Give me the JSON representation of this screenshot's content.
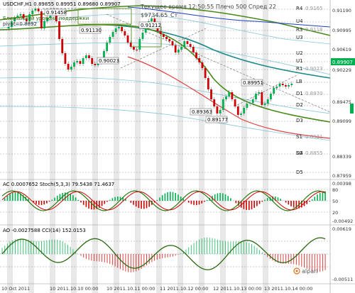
{
  "header": {
    "symbol_info": "USDCHF,H1  0.89855 0.89951 0.89680 0.89907",
    "nearest_level_label": "Ближайший уровень поддержки",
    "pivot_label": "pivot=0.8892",
    "server_time": "Текущее время 12:50:55 Плечо 500 Спред 22",
    "balance": "$9734.65",
    "balance_suffix": "Ст"
  },
  "price_axis": {
    "ticks": [
      "0.91190",
      "0.90995",
      "0.90619",
      "0.90229",
      "0.89907",
      "0.89475",
      "0.89099",
      "0.88339",
      "0.87959"
    ],
    "current": "0.89907",
    "current_color": "#00b050"
  },
  "pivot_levels": [
    {
      "name": "R4",
      "value": "0.9165"
    },
    {
      "name": "U4",
      "value": ""
    },
    {
      "name": "R3",
      "value": "0.9118"
    },
    {
      "name": "U3",
      "value": ""
    },
    {
      "name": "U2",
      "value": ""
    },
    {
      "name": "U1",
      "value": ""
    },
    {
      "name": "R1",
      "value": "0.9023"
    },
    {
      "name": "LB",
      "value": ""
    },
    {
      "name": "D1",
      "value": "0.8970"
    },
    {
      "name": "D2",
      "value": ""
    },
    {
      "name": "D3",
      "value": ""
    },
    {
      "name": "S1",
      "value": "0.8921"
    },
    {
      "name": "D4",
      "value": ""
    },
    {
      "name": "S2",
      "value": "0.8855"
    },
    {
      "name": "D5",
      "value": ""
    }
  ],
  "price_annotations": [
    "0.91458",
    "0.91130",
    "0.91212",
    "0.90023",
    "0.89951",
    "0.89363",
    "0.89177"
  ],
  "indicators": {
    "ac_stoch_label": "AC 0.0007652  Stoch(5,3,3) 79.5438 71.4637",
    "ac_axis": [
      "0.00398",
      "80",
      "50",
      "20",
      "-0.00492"
    ],
    "ao_cci_label": "AO -0.0027588  CCI(14) 152.0153",
    "ao_axis": [
      "0.00619",
      "-0.00511"
    ]
  },
  "time_axis": [
    "10 Oct 2011",
    "10 2011.10.10 00:00",
    "10 2011.10.11 00:00",
    "11 2011.10.12 00:00",
    "12 2011.10.13 00:00",
    "13 2011.10.14 00:00"
  ],
  "brand": "alpari",
  "colors": {
    "bull": "#00b050",
    "bear": "#d00000",
    "ma_green": "#4a8a1a",
    "ma_teal": "#1a8a8a",
    "ma_blue": "#1a40c0",
    "band": "#86c8d8",
    "red_line": "#e04040"
  }
}
